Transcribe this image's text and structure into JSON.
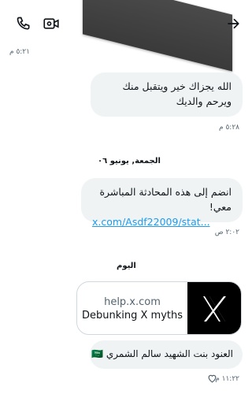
{
  "header": {
    "icons": [
      "phone-icon",
      "video-camera-icon",
      "arrow-right-icon"
    ]
  },
  "messages": [
    {
      "text": "الله يجزاك خير ويتقبل منك ويرحم والديك",
      "time": "٥:٢٨ م"
    },
    {
      "text": "انضم إلى هذه المحادثة المباشرة معي!",
      "link": "x.com/Asdf22009/stat...",
      "time": "٢:٠٢ ص"
    },
    {
      "text": "العنود بنت الشهيد سالم الشمري 🇸🇦",
      "time": "١١:٢٢ م"
    }
  ],
  "top_time": "٥:٢١ م",
  "date_separators": [
    "الجمعة, يونيو ٠٦",
    "اليوم"
  ],
  "link_card": {
    "domain": "help.x.com",
    "title": "Debunking X myths"
  },
  "colors": {
    "bubble": "#eff3f4",
    "link": "#1d9bf0",
    "muted": "#536471"
  }
}
